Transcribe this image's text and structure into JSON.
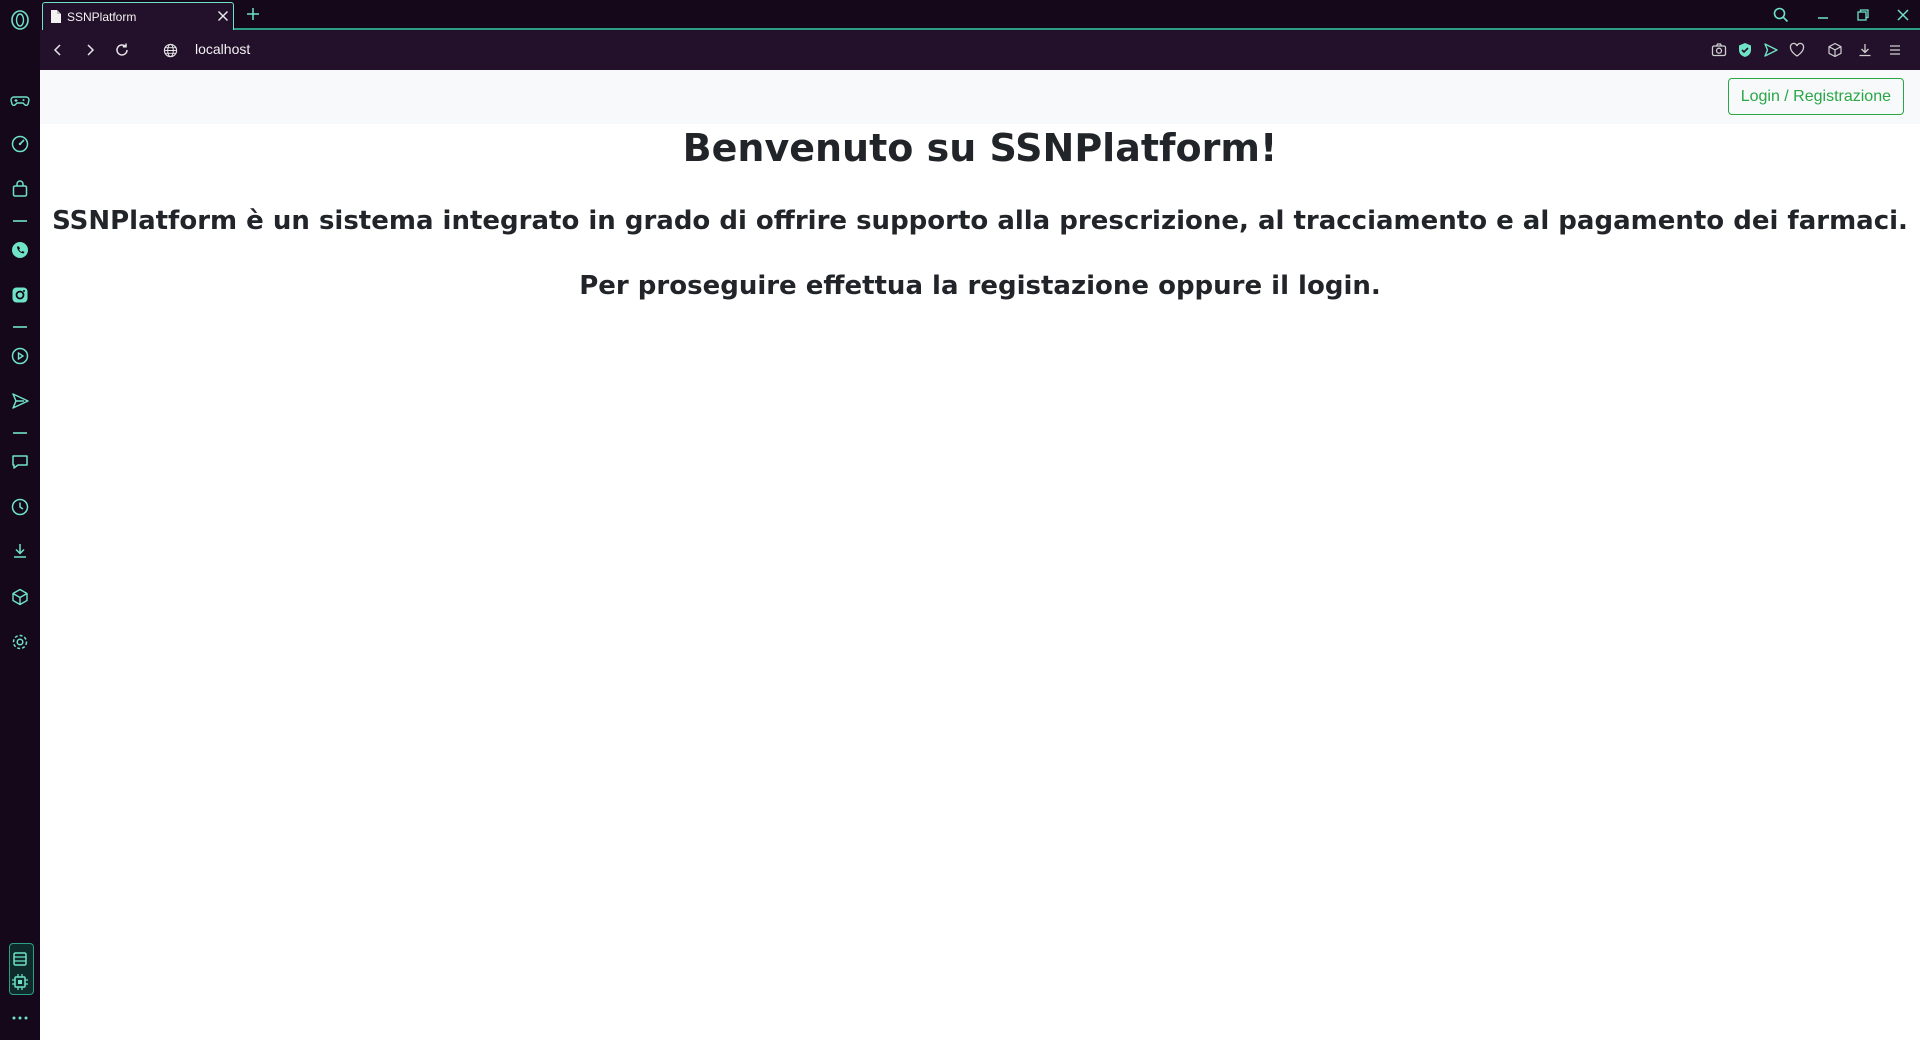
{
  "browser": {
    "tab": {
      "title": "SSNPlatform"
    },
    "address_bar": {
      "url": "localhost"
    },
    "accent_color": "#6fe3c6",
    "sidebar_icons": [
      "opera-logo-icon",
      "game-controller-icon",
      "speedometer-icon",
      "shopping-bag-icon",
      "whatsapp-icon",
      "instagram-icon",
      "player-icon",
      "send-icon",
      "chat-icon",
      "history-icon",
      "download-icon",
      "box-icon",
      "settings-icon",
      "workspace-icon",
      "cpu-icon",
      "more-icon"
    ],
    "toolbar_icons": [
      "camera-icon",
      "shield-icon",
      "send-icon",
      "heart-icon",
      "box-icon",
      "download-icon",
      "menu-icon"
    ]
  },
  "page": {
    "header": {
      "login_button": "Login / Registrazione"
    },
    "title": "Benvenuto su SSNPlatform!",
    "description": "SSNPlatform è un sistema integrato in grado di offrire supporto alla prescrizione, al tracciamento e al pagamento dei farmaci.",
    "call_to_action": "Per proseguire effettua la registazione oppure il login.",
    "button_color": "#28a745",
    "text_color": "#212529"
  }
}
